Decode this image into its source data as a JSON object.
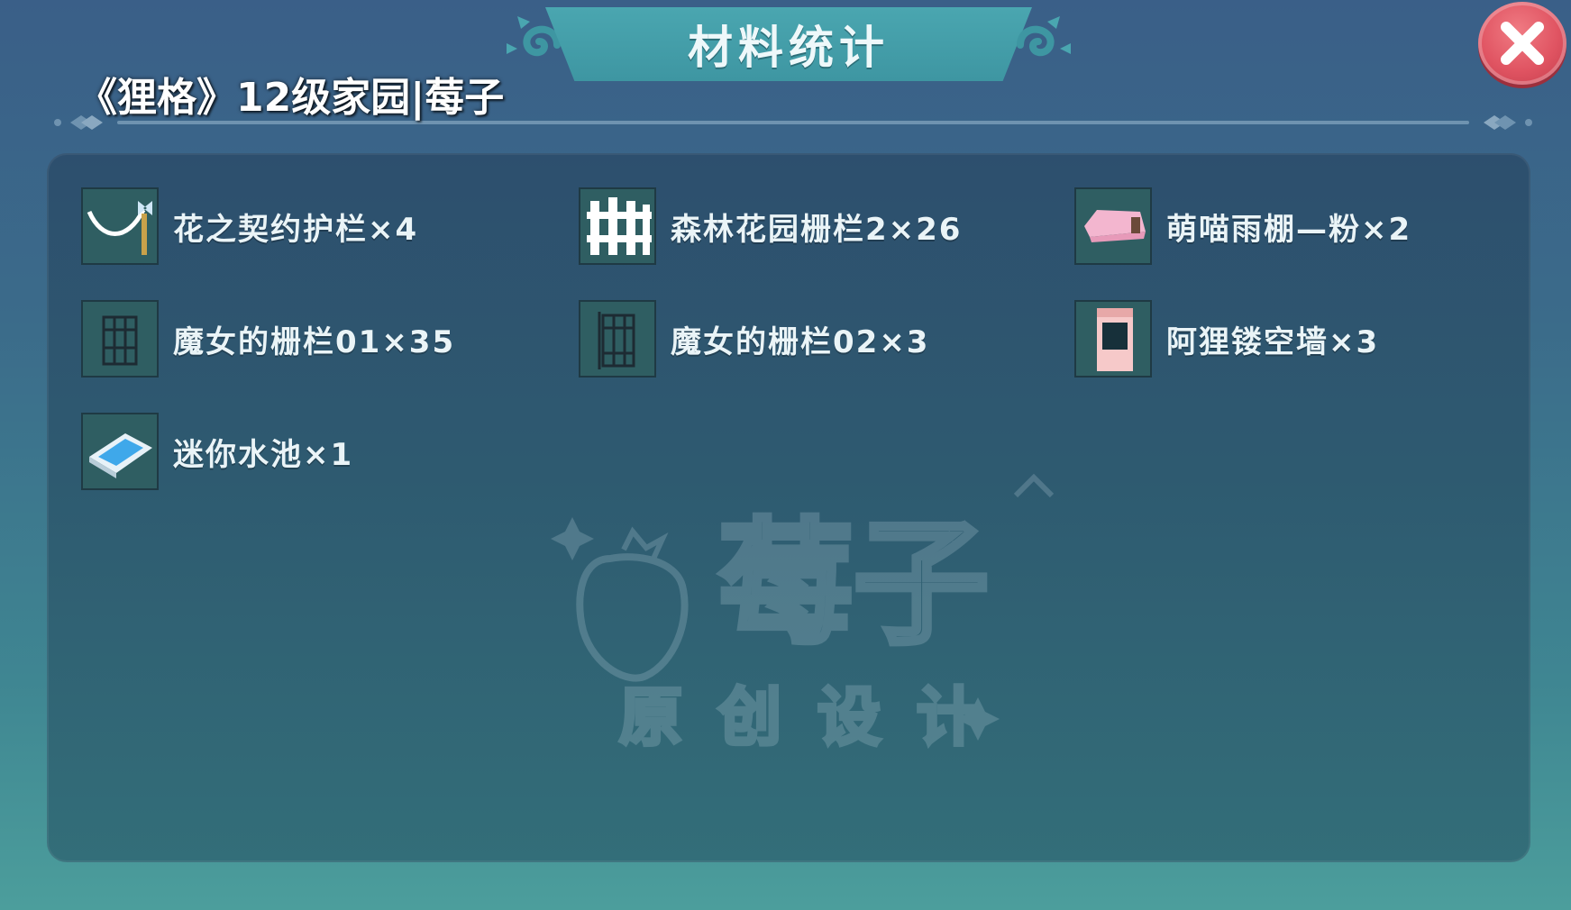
{
  "header": {
    "title": "材料统计",
    "close_icon": "close-icon"
  },
  "overlay": {
    "caption": "《狸格》12级家园|莓子"
  },
  "items": [
    {
      "label": "花之契约护栏×4",
      "icon": "ribbon-railing-icon"
    },
    {
      "label": "森林花园栅栏2×26",
      "icon": "white-picket-fence-icon"
    },
    {
      "label": "萌喵雨棚—粉×2",
      "icon": "pink-awning-icon"
    },
    {
      "label": "魔女的栅栏01×35",
      "icon": "witch-fence-icon"
    },
    {
      "label": "魔女的栅栏02×3",
      "icon": "witch-fence-gate-icon"
    },
    {
      "label": "阿狸镂空墙×3",
      "icon": "hollow-wall-icon"
    },
    {
      "label": "迷你水池×1",
      "icon": "mini-pool-icon"
    }
  ],
  "watermark": {
    "brand": "莓子",
    "subtitle": "原创设计"
  },
  "colors": {
    "panel": "#2d4f6e",
    "banner": "#4aa6b0",
    "close_button": "#e05462",
    "label_text": "#eaf4f7"
  }
}
